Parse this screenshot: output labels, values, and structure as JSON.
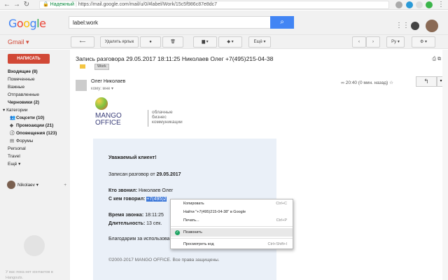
{
  "browser": {
    "secure_label": "Надежный",
    "url": "https://mail.google.com/mail/u/0/#label/Work/15c5f986c87e8dc7"
  },
  "header": {
    "logo": [
      "G",
      "o",
      "o",
      "g",
      "l",
      "e"
    ],
    "search_value": "label:work"
  },
  "toolbar": {
    "app_label": "Gmail ▾",
    "remove_label": "Удалить ярлык",
    "more_label": "Ещё ▾",
    "lang": "Ру ▾"
  },
  "sidebar": {
    "compose": "НАПИСАТЬ",
    "items": [
      {
        "label": "Входящие (8)",
        "bold": true
      },
      {
        "label": "Помеченные"
      },
      {
        "label": "Важные"
      },
      {
        "label": "Отправленные"
      },
      {
        "label": "Черновики (2)",
        "bold": true
      },
      {
        "label": "▾ Категории"
      },
      {
        "label": "Соцсети (10)",
        "bold": true
      },
      {
        "label": "Промоакции (21)",
        "bold": true
      },
      {
        "label": "Оповещения (123)",
        "bold": true
      },
      {
        "label": "Форумы"
      },
      {
        "label": "Personal"
      },
      {
        "label": "Travel"
      },
      {
        "label": "Ещё ▾"
      }
    ],
    "user": "Nikolaev ▾",
    "hangouts_empty": "У вас пока нет контактов в Hangouts."
  },
  "message": {
    "subject": "Запись разговора 29.05.2017 18:11:25 Николаев Олег +7(495)215-04-38",
    "tag": "Work",
    "sender": "Олег Николаев",
    "recipient": "кому: мне ▾",
    "meta": "20:40 (0 мин. назад)",
    "brand": {
      "line1": "MANGO",
      "line2": "OFFICE",
      "tagline1": "облачные",
      "tagline2": "бизнес",
      "tagline3": "коммуникации"
    },
    "greeting": "Уважаемый клиент!",
    "recorded_prefix": "Записан разговор от ",
    "recorded_date": "29.05.2017",
    "caller_label": "Кто звонил:",
    "caller_value": " Николаев Олег",
    "callee_label": "С кем говорил:",
    "callee_value": "+7(495)2",
    "time_label": "Время звонка:",
    "time_value": " 18:11:25",
    "duration_label": "Длительность:",
    "duration_value": " 13 сек.",
    "thanks": "Благодарим за использова",
    "footer": "©2000-2017 MANGO OFFICE. Все права защищены."
  },
  "context_menu": {
    "items": [
      {
        "label": "Копировать",
        "shortcut": "Ctrl+C"
      },
      {
        "label": "Найти \"+7(495)215-04-38\" в Google",
        "shortcut": ""
      },
      {
        "label": "Печать...",
        "shortcut": "Ctrl+P"
      },
      {
        "label": "Позвонить",
        "shortcut": ""
      },
      {
        "label": "Просмотреть код",
        "shortcut": "Ctrl+Shift+I"
      }
    ]
  },
  "colors": {
    "accent": "#d14836",
    "search": "#4285f4",
    "brand_navy": "#3b3f7a"
  }
}
